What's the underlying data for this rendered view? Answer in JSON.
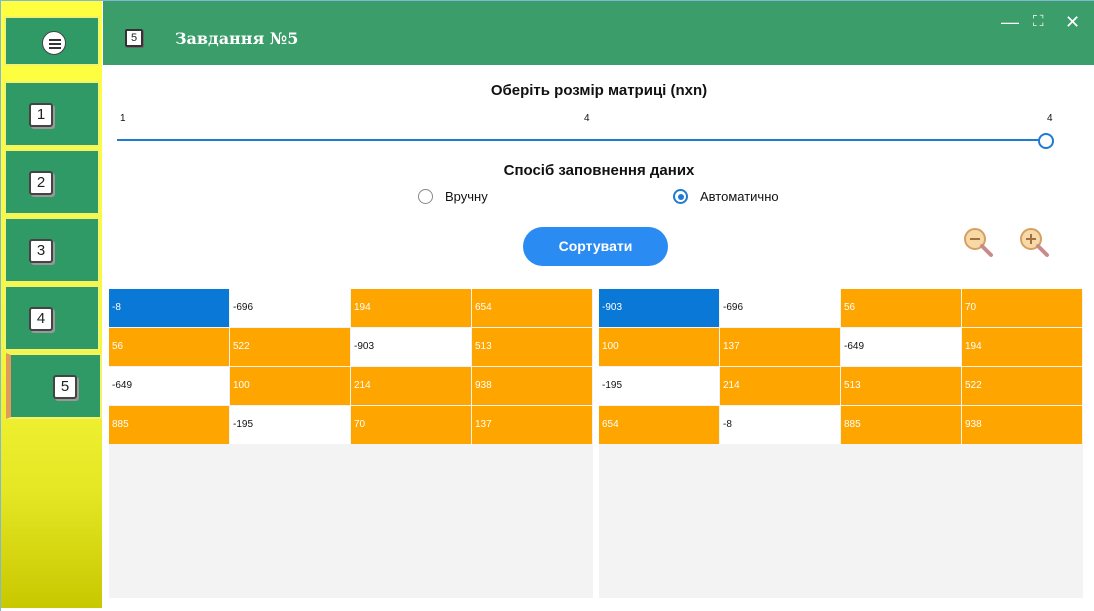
{
  "window": {
    "title": "Завдання №5",
    "title_icon": "5",
    "controls": [
      "—",
      "⛶",
      "✕"
    ]
  },
  "sidebar": {
    "items": [
      {
        "label": "1"
      },
      {
        "label": "2"
      },
      {
        "label": "3"
      },
      {
        "label": "4"
      },
      {
        "label": "5"
      }
    ]
  },
  "matrix_size": {
    "heading": "Оберіть розмір матриці (nxn)",
    "min_label": "1",
    "current_label": "4",
    "max_label": "4",
    "value": 4,
    "min": 1,
    "max": 4
  },
  "fill_mode": {
    "heading": "Спосіб заповнення даних",
    "manual_label": "Вручну",
    "auto_label": "Автоматично",
    "selected": "auto"
  },
  "sort_button": {
    "label": "Сортувати"
  },
  "colors": {
    "accent": "#3a9d6a",
    "button": "#2a8bf2",
    "cell_orange": "#ffa500",
    "cell_blue": "#0a78d7",
    "sidebar_yellow": "#ffff40"
  },
  "left_matrix": [
    [
      {
        "v": "-8",
        "c": "blue"
      },
      {
        "v": "-696",
        "c": "white"
      },
      {
        "v": "194",
        "c": "orange"
      },
      {
        "v": "654",
        "c": "orange"
      }
    ],
    [
      {
        "v": "56",
        "c": "orange"
      },
      {
        "v": "522",
        "c": "orange"
      },
      {
        "v": "-903",
        "c": "white"
      },
      {
        "v": "513",
        "c": "orange"
      }
    ],
    [
      {
        "v": "-649",
        "c": "white"
      },
      {
        "v": "100",
        "c": "orange"
      },
      {
        "v": "214",
        "c": "orange"
      },
      {
        "v": "938",
        "c": "orange"
      }
    ],
    [
      {
        "v": "885",
        "c": "orange"
      },
      {
        "v": "-195",
        "c": "white"
      },
      {
        "v": "70",
        "c": "orange"
      },
      {
        "v": "137",
        "c": "orange"
      }
    ]
  ],
  "right_matrix": [
    [
      {
        "v": "-903",
        "c": "blue"
      },
      {
        "v": "-696",
        "c": "white"
      },
      {
        "v": "56",
        "c": "orange"
      },
      {
        "v": "70",
        "c": "orange"
      }
    ],
    [
      {
        "v": "100",
        "c": "orange"
      },
      {
        "v": "137",
        "c": "orange"
      },
      {
        "v": "-649",
        "c": "white"
      },
      {
        "v": "194",
        "c": "orange"
      }
    ],
    [
      {
        "v": "-195",
        "c": "white"
      },
      {
        "v": "214",
        "c": "orange"
      },
      {
        "v": "513",
        "c": "orange"
      },
      {
        "v": "522",
        "c": "orange"
      }
    ],
    [
      {
        "v": "654",
        "c": "orange"
      },
      {
        "v": "-8",
        "c": "white"
      },
      {
        "v": "885",
        "c": "orange"
      },
      {
        "v": "938",
        "c": "orange"
      }
    ]
  ]
}
